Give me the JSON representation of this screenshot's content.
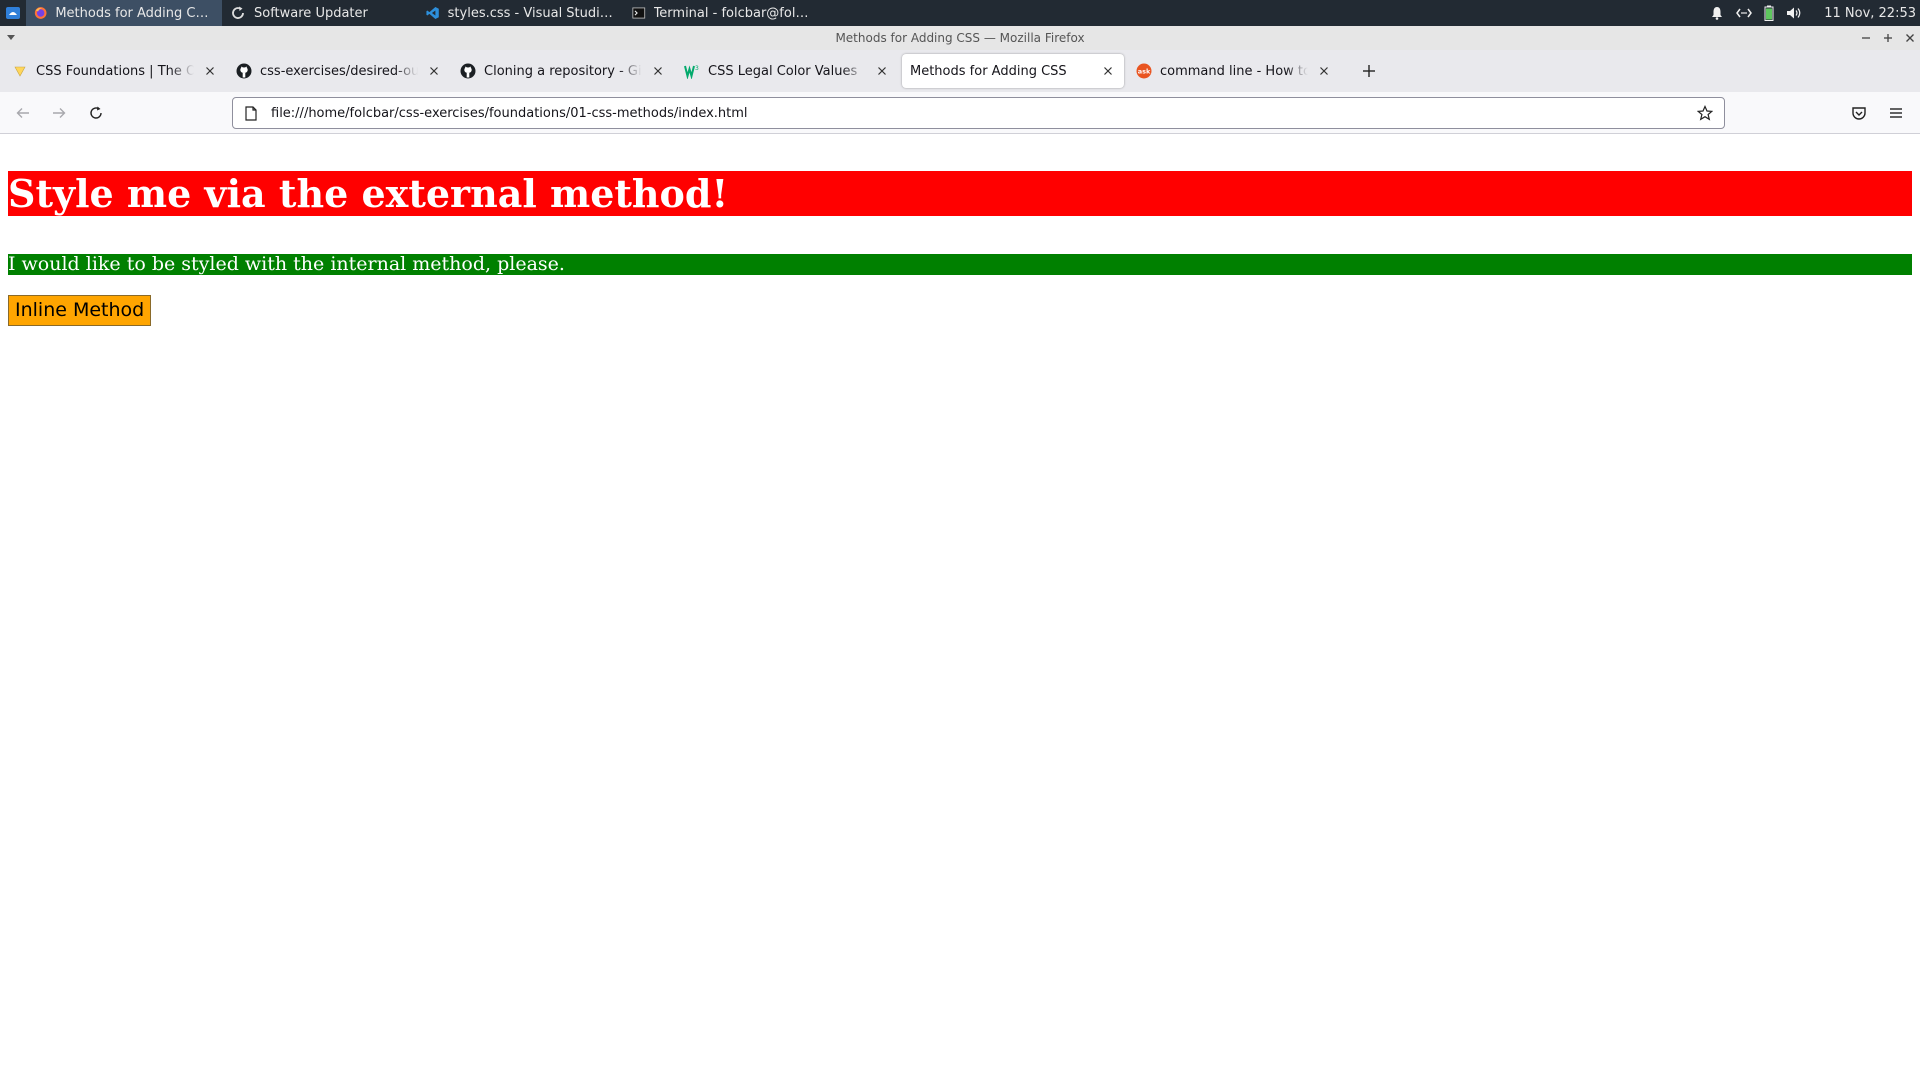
{
  "taskbar": {
    "tasks": [
      {
        "label": "Methods for Adding CSS — ...",
        "icon": "firefox-icon",
        "active": true
      },
      {
        "label": "Software Updater",
        "icon": "refresh-icon",
        "active": false
      },
      {
        "label": "styles.css - Visual Studio Code",
        "icon": "vscode-icon",
        "active": false
      },
      {
        "label": "Terminal - folcbar@folcbar-...",
        "icon": "terminal-icon",
        "active": false
      }
    ],
    "tray_icons": [
      "bell-icon",
      "network-icon",
      "battery-icon",
      "volume-icon"
    ],
    "clock": "11 Nov, 22:53"
  },
  "window": {
    "title": "Methods for Adding CSS — Mozilla Firefox"
  },
  "tabs": [
    {
      "label": "CSS Foundations | The Odin Project",
      "favicon": "odin-favicon",
      "selected": false
    },
    {
      "label": "css-exercises/desired-outcome",
      "favicon": "github-favicon",
      "selected": false
    },
    {
      "label": "Cloning a repository - GitHub Docs",
      "favicon": "github-favicon",
      "selected": false
    },
    {
      "label": "CSS Legal Color Values",
      "favicon": "w3schools-favicon",
      "selected": false
    },
    {
      "label": "Methods for Adding CSS",
      "favicon": "",
      "selected": true
    },
    {
      "label": "command line - How to open",
      "favicon": "askubuntu-favicon",
      "selected": false
    }
  ],
  "navbar": {
    "url": "file:///home/folcbar/css-exercises/foundations/01-css-methods/index.html"
  },
  "page": {
    "heading": "Style me via the external method!",
    "paragraph": "I would like to be styled with the internal method, please.",
    "button_label": "Inline Method"
  },
  "colors": {
    "heading_bg": "#ff0000",
    "paragraph_bg": "#008000",
    "button_bg": "#ffa500",
    "taskbar_bg": "#222a33",
    "active_task_bg": "#3d4f64"
  }
}
